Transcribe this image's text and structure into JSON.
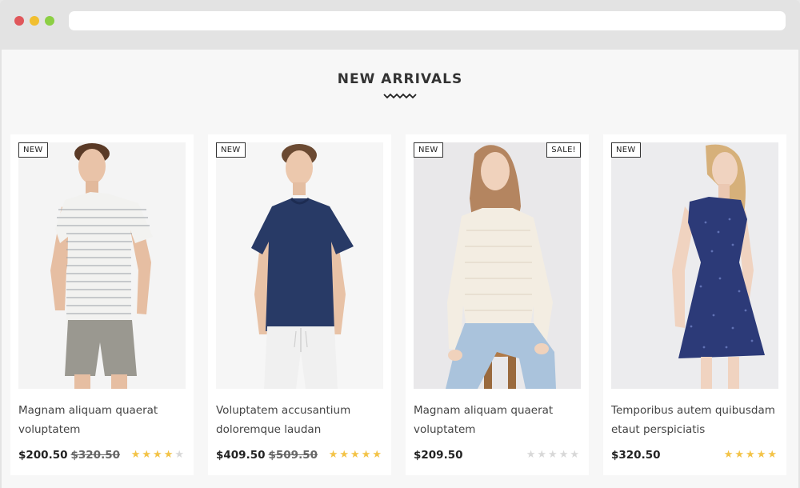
{
  "section": {
    "title": "NEW ARRIVALS"
  },
  "colors": {
    "star_on": "#f3c347",
    "star_off": "#d8d8d8"
  },
  "products": [
    {
      "badge": "NEW",
      "sale_badge": "",
      "name": "Magnam aliquam quaerat voluptatem",
      "price": "$200.50",
      "old_price": "$320.50",
      "rating": 4,
      "rating_max": 5,
      "image": "man-striped-tshirt"
    },
    {
      "badge": "NEW",
      "sale_badge": "",
      "name": "Voluptatem accusantium doloremque laudan",
      "price": "$409.50",
      "old_price": "$509.50",
      "rating": 5,
      "rating_max": 5,
      "image": "man-navy-tshirt"
    },
    {
      "badge": "NEW",
      "sale_badge": "SALE!",
      "name": "Magnam aliquam quaerat voluptatem",
      "price": "$209.50",
      "old_price": "",
      "rating": 0,
      "rating_max": 5,
      "image": "woman-cream-sweater"
    },
    {
      "badge": "NEW",
      "sale_badge": "",
      "name": "Temporibus autem quibusdam etaut perspiciatis",
      "price": "$320.50",
      "old_price": "",
      "rating": 5,
      "rating_max": 5,
      "image": "woman-navy-dress"
    }
  ]
}
